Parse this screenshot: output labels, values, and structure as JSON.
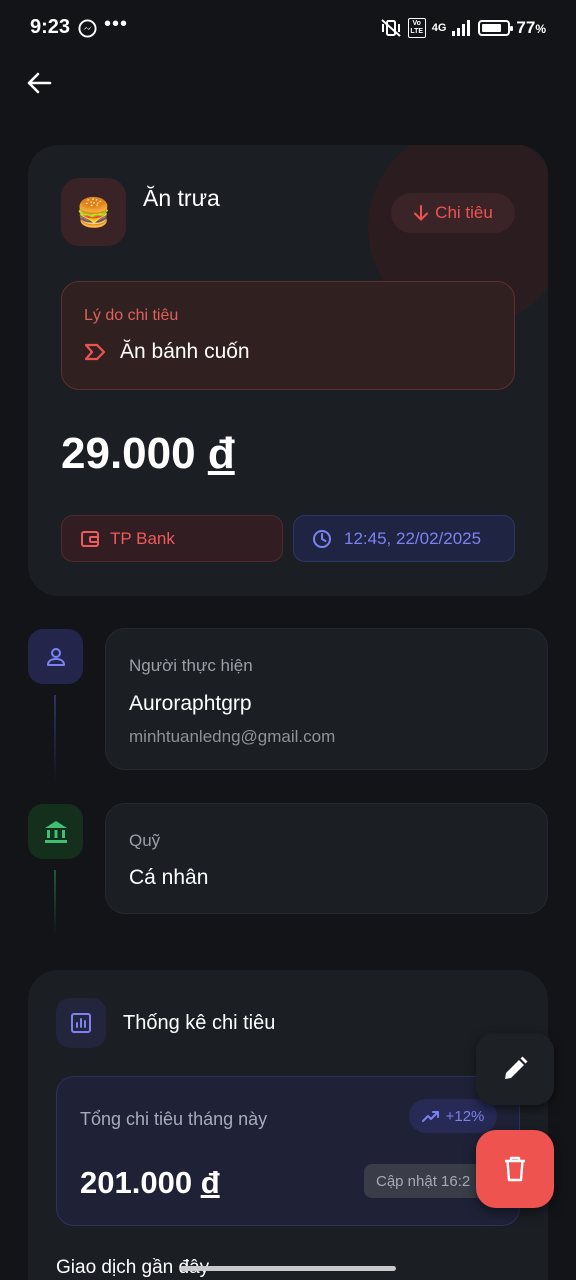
{
  "status_bar": {
    "time": "9:23",
    "dots": "•••",
    "network": "4G",
    "volte": "Vo LTE",
    "battery_percent": "77",
    "battery_symbol": "%",
    "battery_level": 0.77
  },
  "transaction": {
    "emoji": "🍔",
    "title": "Ăn trưa",
    "type_label": "Chi tiêu",
    "reason_label": "Lý do chi tiêu",
    "reason_value": "Ăn bánh cuốn",
    "amount": "29.000",
    "currency": "đ",
    "bank": "TP Bank",
    "datetime": "12:45, 22/02/2025"
  },
  "performer": {
    "label": "Người thực hiện",
    "name": "Auroraphtgrp",
    "email": "minhtuanledng@gmail.com"
  },
  "fund": {
    "label": "Quỹ",
    "value": "Cá nhân"
  },
  "stats": {
    "title": "Thống kê chi tiêu",
    "month_label": "Tổng chi tiêu tháng này",
    "trend": "+12%",
    "month_amount": "201.000",
    "currency": "đ",
    "updated": "Cập nhật 16:2",
    "recent_title": "Giao dịch gần đây"
  },
  "colors": {
    "expense": "#ef5350",
    "accent": "#7b83f3",
    "fund_green": "#3fbf6f"
  },
  "icons": {
    "back": "arrow-left-icon",
    "type": "arrow-down-icon",
    "reason": "label-tag-icon",
    "bank": "wallet-icon",
    "time": "clock-icon",
    "performer": "person-icon",
    "fund": "bank-icon",
    "stats": "bar-chart-icon",
    "trend": "trending-up-icon",
    "edit": "pencil-icon",
    "delete": "trash-icon"
  }
}
